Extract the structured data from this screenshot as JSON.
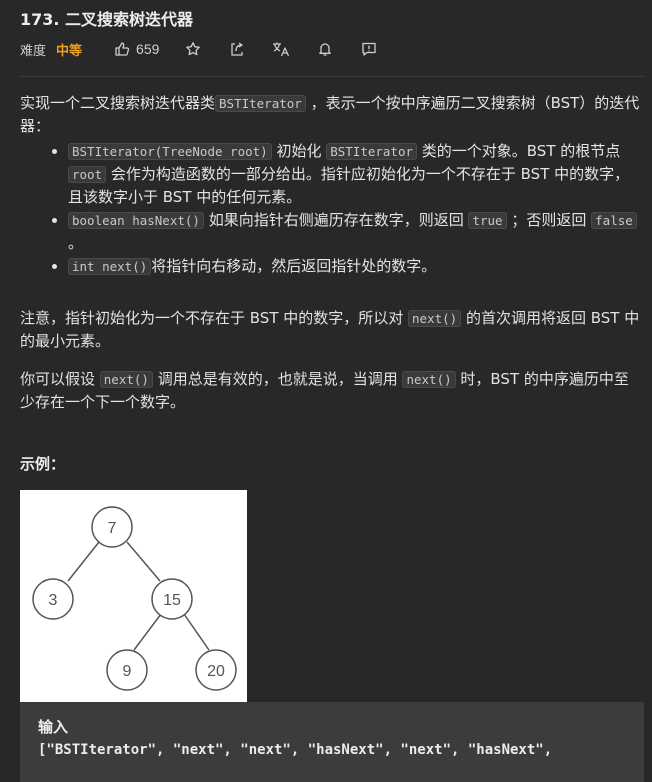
{
  "header": {
    "title": "173. 二叉搜索树迭代器",
    "difficulty_label": "难度",
    "difficulty": "中等",
    "likes": "659"
  },
  "toolbar_icons": [
    "thumbs-up-icon",
    "star-icon",
    "share-icon",
    "translate-icon",
    "bell-icon",
    "feedback-icon"
  ],
  "colors": {
    "background": "#282828",
    "difficulty": "#f0a020",
    "code_bg": "#3a3a3a"
  },
  "description": {
    "intro_a": "实现一个二叉搜索树迭代器类",
    "intro_code": "BSTIterator",
    "intro_b": " ，表示一个按中序遍历二叉搜索树（BST）的迭代器：",
    "b1_code1": "BSTIterator(TreeNode root)",
    "b1_a": " 初始化 ",
    "b1_code2": "BSTIterator",
    "b1_b": " 类的一个对象。BST 的根节点 ",
    "b1_code3": "root",
    "b1_c": " 会作为构造函数的一部分给出。指针应初始化为一个不存在于 BST 中的数字，且该数字小于 BST 中的任何元素。",
    "b2_code1": "boolean hasNext()",
    "b2_a": " 如果向指针右侧遍历存在数字，则返回 ",
    "b2_code2": "true",
    "b2_b": " ；否则返回 ",
    "b2_code3": "false",
    "b2_c": " 。",
    "b3_code": "int next()",
    "b3_a": "将指针向右移动，然后返回指针处的数字。",
    "note_a": "注意，指针初始化为一个不存在于 BST 中的数字，所以对 ",
    "note_code": "next()",
    "note_b": " 的首次调用将返回 BST 中的最小元素。",
    "assume_a": "你可以假设 ",
    "assume_code1": "next()",
    "assume_b": " 调用总是有效的，也就是说，当调用 ",
    "assume_code2": "next()",
    "assume_c": " 时，BST 的中序遍历中至少存在一个下一个数字。"
  },
  "example": {
    "label": "示例：",
    "tree_nodes": [
      "7",
      "3",
      "15",
      "9",
      "20"
    ],
    "input_label": "输入",
    "input_line": "[\"BSTIterator\", \"next\", \"next\", \"hasNext\", \"next\", \"hasNext\","
  }
}
